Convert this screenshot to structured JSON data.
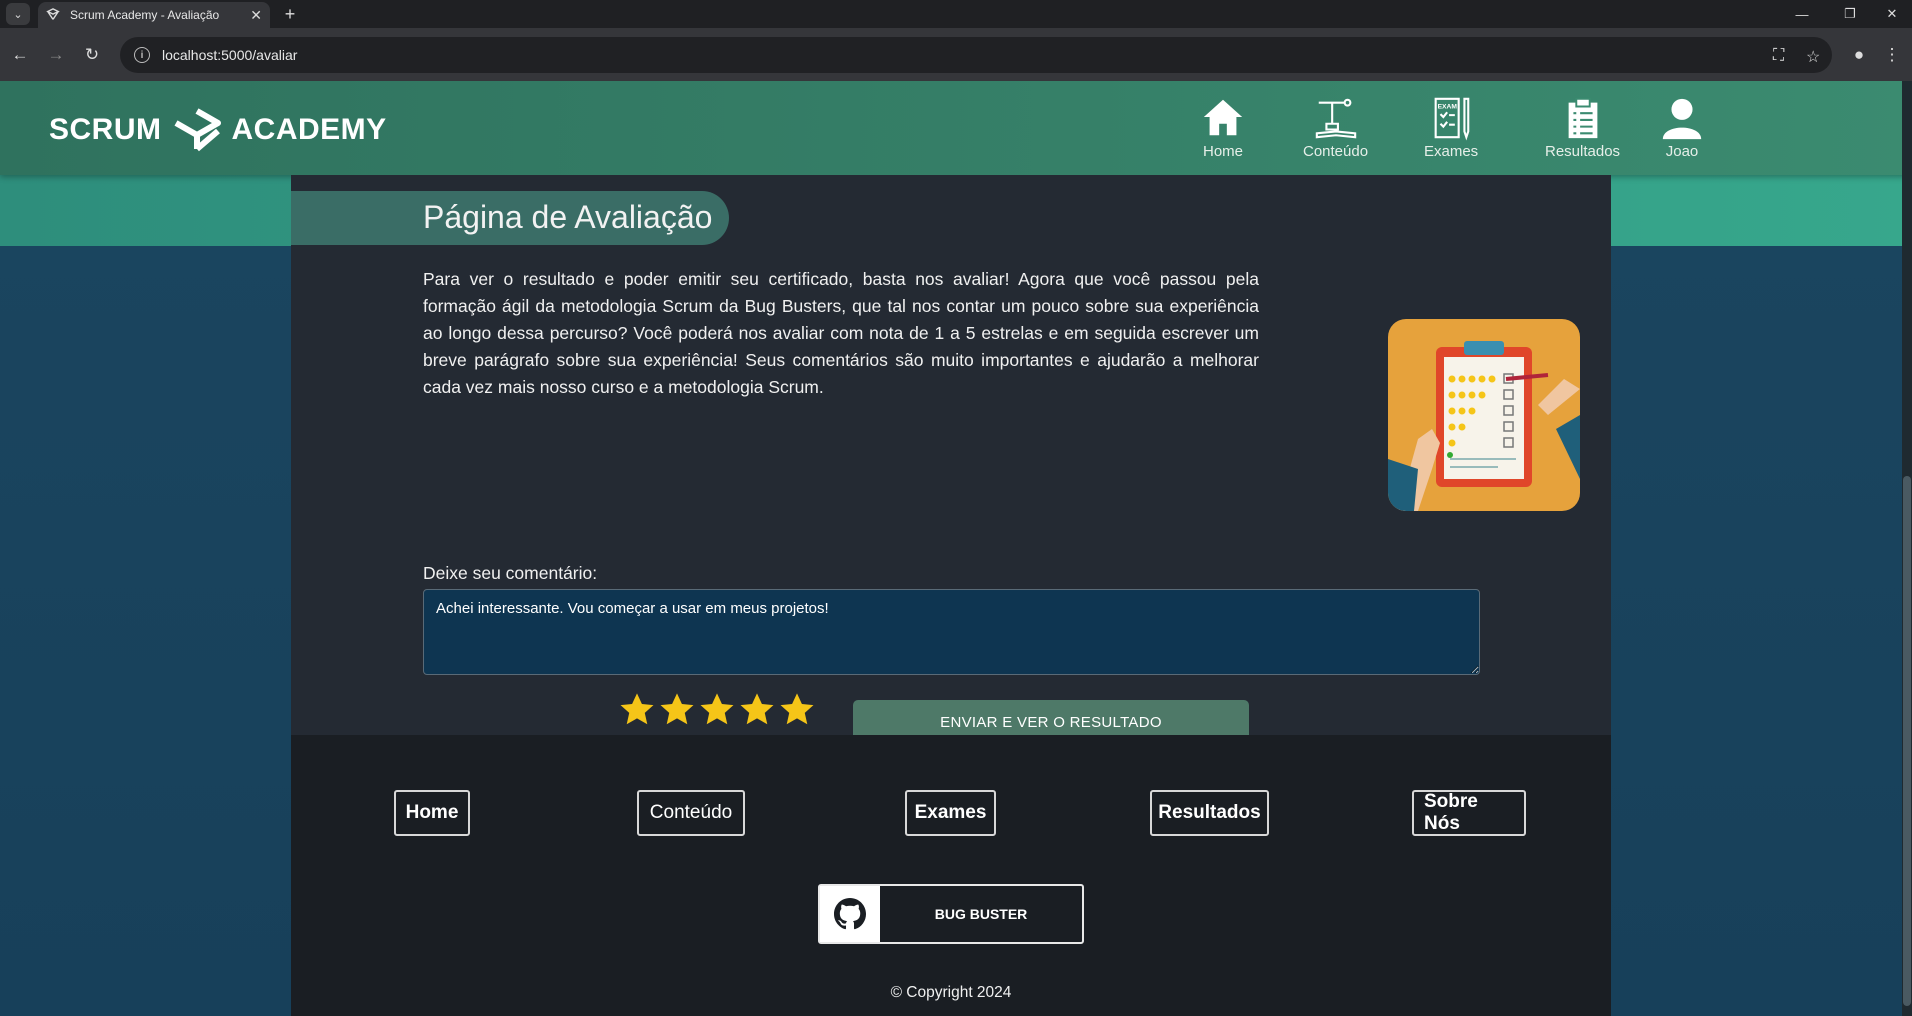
{
  "browser": {
    "tab_title": "Scrum Academy - Avaliação",
    "url": "localhost:5000/avaliar"
  },
  "header": {
    "logo_left": "SCRUM",
    "logo_right": "ACADEMY",
    "nav": [
      {
        "label": "Home",
        "icon": "home-icon"
      },
      {
        "label": "Conteúdo",
        "icon": "content-icon"
      },
      {
        "label": "Exames",
        "icon": "exam-icon"
      },
      {
        "label": "Resultados",
        "icon": "clipboard-icon"
      },
      {
        "label": "Joao",
        "icon": "user-icon"
      }
    ]
  },
  "main": {
    "title": "Página de Avaliação",
    "intro": "Para ver o resultado e poder emitir seu certificado, basta nos avaliar! Agora que você passou pela formação ágil da metodologia Scrum da Bug Busters, que tal nos contar um pouco sobre sua experiência ao longo dessa percurso? Você poderá nos avaliar com nota de 1 a 5 estrelas e em seguida escrever um breve parágrafo sobre sua experiência! Seus comentários são muito importantes e ajudarão a melhorar cada vez mais nosso curso e a metodologia Scrum.",
    "comment_label": "Deixe seu comentário:",
    "comment_value": "Achei interessante. Vou começar a usar em meus projetos!",
    "rating": 5,
    "rating_max": 5,
    "star_color": "#f5c518",
    "submit_label": "ENVIAR E VER O RESULTADO"
  },
  "footer": {
    "links": [
      "Home",
      "Conteúdo",
      "Exames",
      "Resultados",
      "Sobre Nós"
    ],
    "github_label": "BUG BUSTER",
    "copyright": "© Copyright 2024"
  }
}
